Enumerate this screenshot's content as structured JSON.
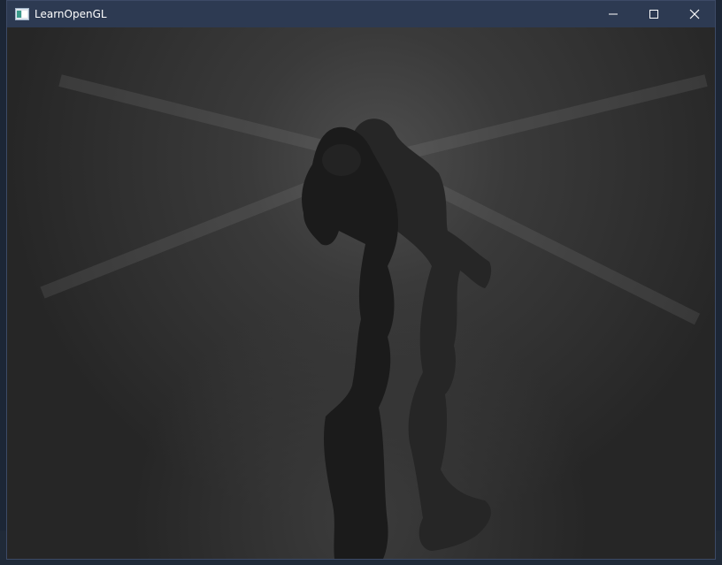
{
  "window": {
    "title": "LearnOpenGL",
    "icon": "opengl-app-icon"
  },
  "controls": {
    "minimize_icon": "minimize-icon",
    "maximize_icon": "maximize-icon",
    "close_icon": "close-icon"
  },
  "scene": {
    "subject": "character-model-silhouette",
    "background_color": "#2e2e2e",
    "highlight_color": "#4a4a4a",
    "model_color": "#1f1f1f"
  },
  "colors": {
    "titlebar": "#2d3a52",
    "border": "#3c4a66"
  }
}
